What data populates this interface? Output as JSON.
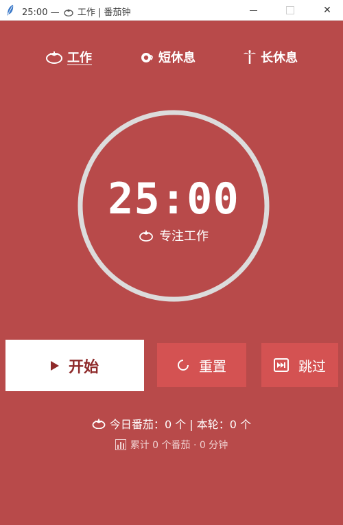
{
  "window": {
    "title_time": "25:00 —",
    "title_rest": "工作 | 番茄钟",
    "close_glyph": "✕"
  },
  "tabs": [
    {
      "label": "工作",
      "icon": "tomato-icon",
      "active": true
    },
    {
      "label": "短休息",
      "icon": "coffee-icon",
      "active": false
    },
    {
      "label": "长休息",
      "icon": "palm-tree-icon",
      "active": false
    }
  ],
  "timer": {
    "time": "25:00",
    "mode_label": "专注工作"
  },
  "buttons": {
    "start": "开始",
    "reset": "重置",
    "skip": "跳过"
  },
  "stats": {
    "today_label": "今日番茄：",
    "today_count": "0 个",
    "separator": " | ",
    "round_label": "本轮：",
    "round_count": "0 个",
    "total": "累计 0 个番茄 · 0 分钟"
  },
  "colors": {
    "background": "#b84a4a",
    "secondary_button": "#d45252",
    "primary_text": "#8e2a2a",
    "ring": "#dcdcdc"
  }
}
